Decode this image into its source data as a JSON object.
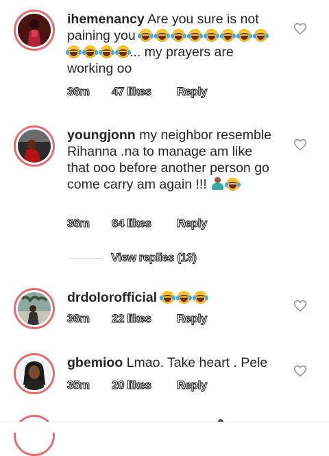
{
  "comments": [
    {
      "username": "ihemenancy",
      "text_part1": "Are you sure is not paining you",
      "text_part2": "... my prayers are working oo",
      "time": "36m",
      "likes": "47 likes",
      "reply": "Reply"
    },
    {
      "username": "youngjonn",
      "text": "my neighbor resemble Rihanna .na to manage am like that ooo before another person go come carry am again !!!",
      "time": "36m",
      "likes": "64 likes",
      "reply": "Reply",
      "view_replies": "View replies (13)"
    },
    {
      "username": "drdolorofficial",
      "time": "36m",
      "likes": "22 likes",
      "reply": "Reply"
    },
    {
      "username": "gbemioo",
      "text": "Lmao. Take heart . Pele",
      "time": "35m",
      "likes": "20 likes",
      "reply": "Reply"
    }
  ],
  "icons": {
    "like": "heart-outline-icon",
    "laugh": "face-with-tears-of-joy-emoji",
    "shrug": "person-shrugging-emoji"
  },
  "colors": {
    "story_ring": "#e8696b",
    "text": "#262626",
    "heart": "#8e8e8e",
    "emoji": "#f7c333"
  }
}
